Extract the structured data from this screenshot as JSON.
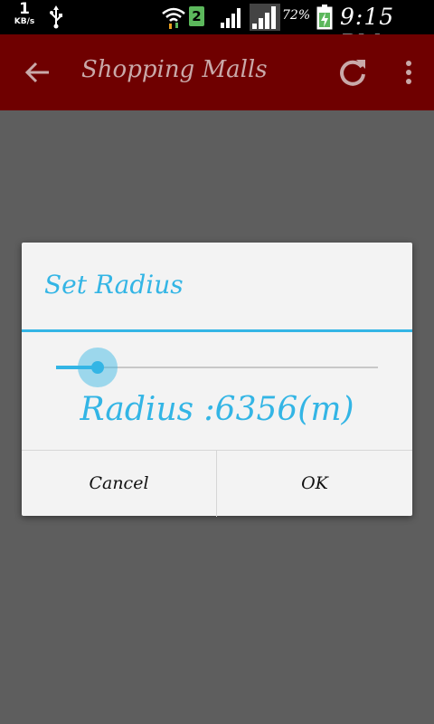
{
  "status_bar": {
    "net_speed_value": "1",
    "net_speed_unit": "KB/s",
    "sim_slot": "2",
    "battery_percent": "72%",
    "time": "9:15 PM",
    "icons": [
      "usb-icon",
      "wifi-icon",
      "signal-icon",
      "battery-icon"
    ]
  },
  "app_bar": {
    "title": "Shopping Malls",
    "color": "#6f0000",
    "icons": [
      "back-arrow-icon",
      "refresh-icon",
      "overflow-menu-icon"
    ]
  },
  "dialog": {
    "title": "Set Radius",
    "accent": "#33b5e5",
    "slider_fraction": 0.13,
    "radius_text": "Radius :6356(m)",
    "buttons": {
      "cancel": "Cancel",
      "ok": "OK"
    }
  }
}
